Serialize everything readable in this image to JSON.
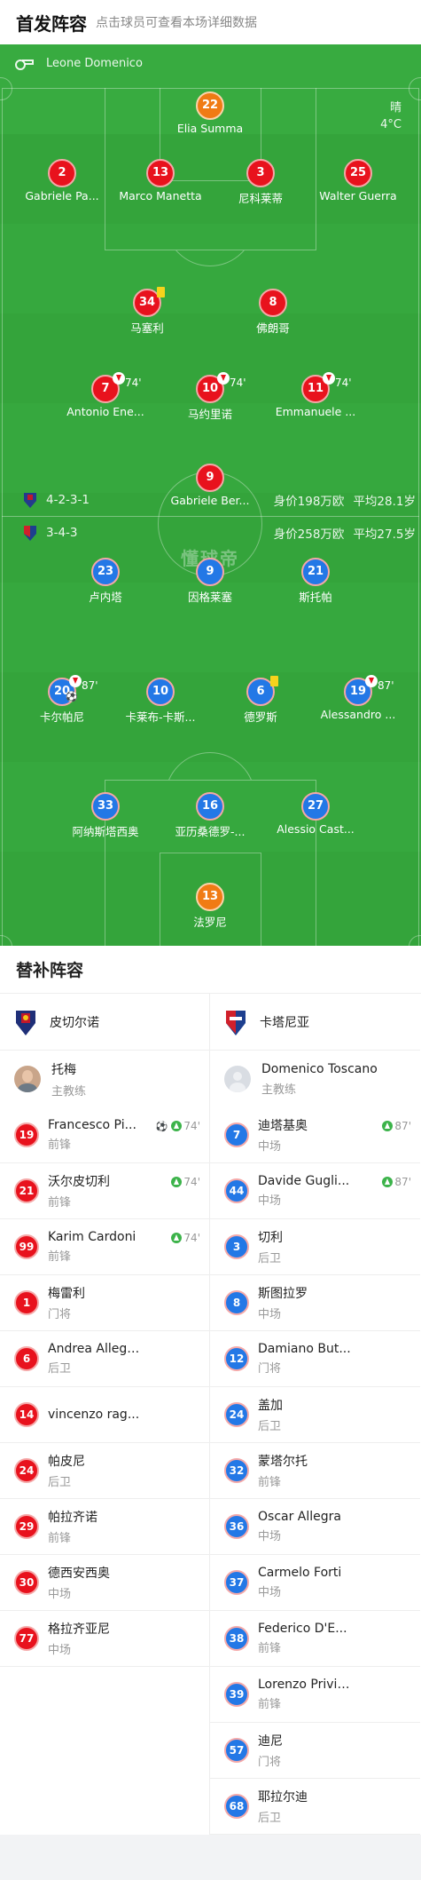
{
  "header": {
    "title": "首发阵容",
    "hint": "点击球员可查看本场详细数据"
  },
  "referee": {
    "name": "Leone Domenico",
    "icon": "whistle-icon"
  },
  "weather": {
    "condition": "晴",
    "temperature": "4°C"
  },
  "home_team": {
    "formation": "4-2-3-1",
    "value": "身价198万欧",
    "avg_age": "平均28.1岁"
  },
  "away_team": {
    "formation": "3-4-3",
    "value": "身价258万欧",
    "avg_age": "平均27.5岁"
  },
  "watermark": "懂球帝",
  "home_players": [
    {
      "num": "22",
      "name": "Elia Summa"
    },
    {
      "num": "2",
      "name": "Gabriele Pa..."
    },
    {
      "num": "13",
      "name": "Marco Manetta"
    },
    {
      "num": "3",
      "name": "尼科莱蒂"
    },
    {
      "num": "25",
      "name": "Walter Guerra"
    },
    {
      "num": "34",
      "name": "马塞利"
    },
    {
      "num": "8",
      "name": "佛朗哥"
    },
    {
      "num": "7",
      "name": "Antonio Ene...",
      "sub": "74'"
    },
    {
      "num": "10",
      "name": "马约里诺",
      "sub": "74'"
    },
    {
      "num": "11",
      "name": "Emmanuele ...",
      "sub": "74'"
    },
    {
      "num": "9",
      "name": "Gabriele Ber..."
    }
  ],
  "away_players": [
    {
      "num": "23",
      "name": "卢内塔"
    },
    {
      "num": "9",
      "name": "因格莱塞"
    },
    {
      "num": "21",
      "name": "斯托帕"
    },
    {
      "num": "20",
      "name": "卡尔帕尼",
      "sub": "87'"
    },
    {
      "num": "10",
      "name": "卡莱布-卡斯..."
    },
    {
      "num": "6",
      "name": "德罗斯"
    },
    {
      "num": "19",
      "name": "Alessandro ...",
      "sub": "87'"
    },
    {
      "num": "33",
      "name": "阿纳斯塔西奥"
    },
    {
      "num": "16",
      "name": "亚历桑德罗-..."
    },
    {
      "num": "27",
      "name": "Alessio Cast..."
    },
    {
      "num": "13",
      "name": "法罗尼"
    }
  ],
  "subs": {
    "title": "替补阵容",
    "left": {
      "team": "皮切尔诺",
      "coach": {
        "name": "托梅",
        "role": "主教练"
      },
      "players": [
        {
          "num": "19",
          "name": "Francesco Pi...",
          "pos": "前锋",
          "event": "74'"
        },
        {
          "num": "21",
          "name": "沃尔皮切利",
          "pos": "前锋",
          "event": "74'"
        },
        {
          "num": "99",
          "name": "Karim Cardoni",
          "pos": "前锋",
          "event": "74'"
        },
        {
          "num": "1",
          "name": "梅雷利",
          "pos": "门将",
          "event": ""
        },
        {
          "num": "6",
          "name": "Andrea Allegr...",
          "pos": "后卫",
          "event": ""
        },
        {
          "num": "14",
          "name": "vincenzo rag...",
          "pos": "",
          "event": ""
        },
        {
          "num": "24",
          "name": "帕皮尼",
          "pos": "后卫",
          "event": ""
        },
        {
          "num": "29",
          "name": "帕拉齐诺",
          "pos": "前锋",
          "event": ""
        },
        {
          "num": "30",
          "name": "德西安西奥",
          "pos": "中场",
          "event": ""
        },
        {
          "num": "77",
          "name": "格拉齐亚尼",
          "pos": "中场",
          "event": ""
        }
      ]
    },
    "right": {
      "team": "卡塔尼亚",
      "coach": {
        "name": "Domenico Toscano",
        "role": "主教练"
      },
      "players": [
        {
          "num": "7",
          "name": "迪塔基奥",
          "pos": "中场",
          "event": "87'"
        },
        {
          "num": "44",
          "name": "Davide Gugli...",
          "pos": "中场",
          "event": "87'"
        },
        {
          "num": "3",
          "name": "切利",
          "pos": "后卫",
          "event": ""
        },
        {
          "num": "8",
          "name": "斯图拉罗",
          "pos": "中场",
          "event": ""
        },
        {
          "num": "12",
          "name": "Damiano But...",
          "pos": "门将",
          "event": ""
        },
        {
          "num": "24",
          "name": "盖加",
          "pos": "后卫",
          "event": ""
        },
        {
          "num": "32",
          "name": "蒙塔尔托",
          "pos": "前锋",
          "event": ""
        },
        {
          "num": "36",
          "name": "Oscar Allegra",
          "pos": "中场",
          "event": ""
        },
        {
          "num": "37",
          "name": "Carmelo Forti",
          "pos": "中场",
          "event": ""
        },
        {
          "num": "38",
          "name": "Federico D'E...",
          "pos": "前锋",
          "event": ""
        },
        {
          "num": "39",
          "name": "Lorenzo Privit...",
          "pos": "前锋",
          "event": ""
        },
        {
          "num": "57",
          "name": "迪尼",
          "pos": "门将",
          "event": ""
        },
        {
          "num": "68",
          "name": "耶拉尔迪",
          "pos": "后卫",
          "event": ""
        }
      ]
    }
  }
}
